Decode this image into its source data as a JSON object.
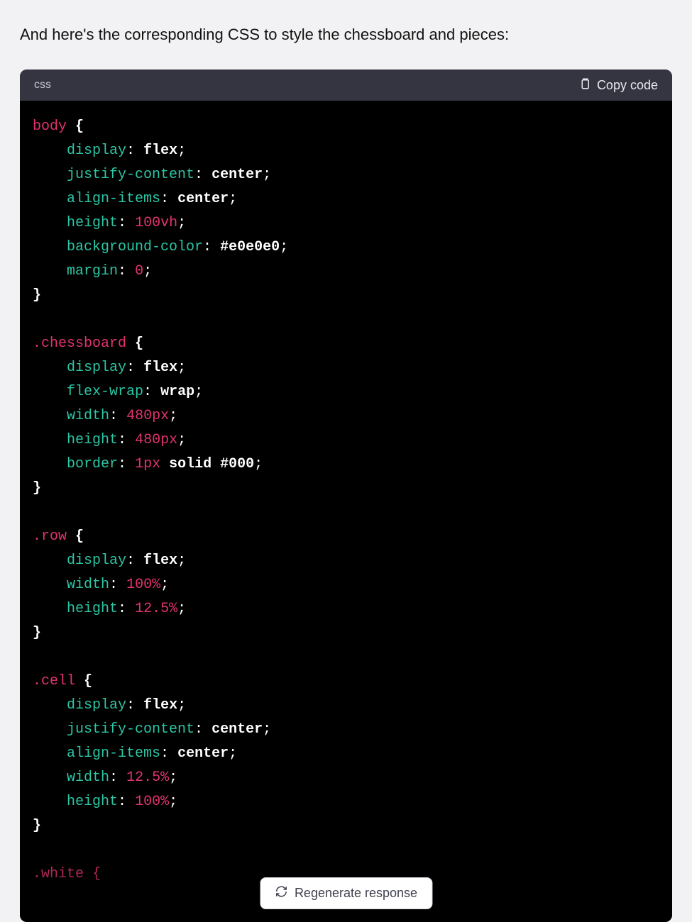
{
  "intro": "And here's the corresponding CSS to style the chessboard and pieces:",
  "header": {
    "language": "css",
    "copy_label": "Copy code"
  },
  "regenerate_label": "Regenerate response",
  "code": {
    "rules": [
      {
        "selector": "body",
        "decls": [
          {
            "property": "display",
            "value": "flex",
            "kind": "kw"
          },
          {
            "property": "justify-content",
            "value": "center",
            "kind": "kw"
          },
          {
            "property": "align-items",
            "value": "center",
            "kind": "kw"
          },
          {
            "property": "height",
            "value": "100vh",
            "kind": "num"
          },
          {
            "property": "background-color",
            "value": "#e0e0e0",
            "kind": "hex"
          },
          {
            "property": "margin",
            "value": "0",
            "kind": "num"
          }
        ]
      },
      {
        "selector": ".chessboard",
        "decls": [
          {
            "property": "display",
            "value": "flex",
            "kind": "kw"
          },
          {
            "property": "flex-wrap",
            "value": "wrap",
            "kind": "kw"
          },
          {
            "property": "width",
            "value": "480px",
            "kind": "num"
          },
          {
            "property": "height",
            "value": "480px",
            "kind": "num"
          },
          {
            "property": "border",
            "value": "1px solid #000",
            "kind": "border"
          }
        ]
      },
      {
        "selector": ".row",
        "decls": [
          {
            "property": "display",
            "value": "flex",
            "kind": "kw"
          },
          {
            "property": "width",
            "value": "100%",
            "kind": "num"
          },
          {
            "property": "height",
            "value": "12.5%",
            "kind": "num"
          }
        ]
      },
      {
        "selector": ".cell",
        "decls": [
          {
            "property": "display",
            "value": "flex",
            "kind": "kw"
          },
          {
            "property": "justify-content",
            "value": "center",
            "kind": "kw"
          },
          {
            "property": "align-items",
            "value": "center",
            "kind": "kw"
          },
          {
            "property": "width",
            "value": "12.5%",
            "kind": "num"
          },
          {
            "property": "height",
            "value": "100%",
            "kind": "num"
          }
        ]
      }
    ],
    "trailing_partial_selector": ".white {"
  }
}
